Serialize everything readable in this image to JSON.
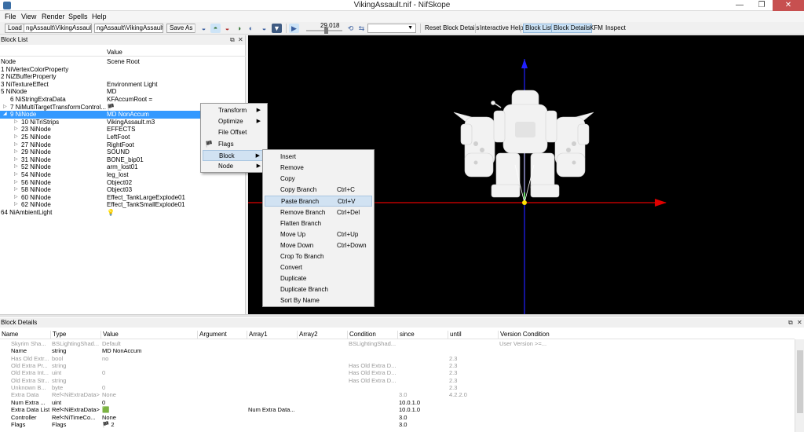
{
  "window": {
    "title": "VikingAssault.nif - NifSkope",
    "min": "—",
    "max": "❐",
    "close": "✕"
  },
  "menubar": [
    "File",
    "View",
    "Render",
    "Spells",
    "Help"
  ],
  "toolbar": {
    "load": "Load",
    "path1": "ngAssault\\VikingAssault.nif",
    "path2": "ngAssault\\VikingAssault.nif",
    "save_as": "Save As",
    "time": "29.018",
    "reset_block_details": "Reset Block Details",
    "interactive_help": "Interactive Help",
    "block_list": "Block List",
    "block_details": "Block Details",
    "kfm": "KFM",
    "inspect": "Inspect"
  },
  "blocklist": {
    "title": "Block List",
    "col_value": "Value",
    "rows": [
      {
        "name": "Node",
        "value": "Scene Root",
        "indent": 0,
        "tri": ""
      },
      {
        "name": "1 NiVertexColorProperty",
        "value": "",
        "indent": 0,
        "tri": ""
      },
      {
        "name": "2 NiZBufferProperty",
        "value": "",
        "indent": 0,
        "tri": ""
      },
      {
        "name": "3 NiTextureEffect",
        "value": "Environment Light",
        "indent": 0,
        "tri": ""
      },
      {
        "name": "5 NiNode",
        "value": "MD",
        "indent": 0,
        "tri": ""
      },
      {
        "name": "6 NiStringExtraData",
        "value": "KFAccumRoot =",
        "indent": 1,
        "tri": ""
      },
      {
        "name": "7 NiMultiTargetTransformControl...",
        "value": "🏴",
        "indent": 1,
        "tri": "▷"
      },
      {
        "name": "9 NiNode",
        "value": "MD NonAccum",
        "indent": 1,
        "tri": "◢",
        "selected": true
      },
      {
        "name": "10 NiTriStrips",
        "value": "VikingAssault.m3",
        "indent": 2,
        "tri": "▷"
      },
      {
        "name": "23 NiNode",
        "value": "EFFECTS",
        "indent": 2,
        "tri": "▷"
      },
      {
        "name": "25 NiNode",
        "value": "LeftFoot",
        "indent": 2,
        "tri": "▷"
      },
      {
        "name": "27 NiNode",
        "value": "RightFoot",
        "indent": 2,
        "tri": "▷"
      },
      {
        "name": "29 NiNode",
        "value": "SOUND",
        "indent": 2,
        "tri": "▷"
      },
      {
        "name": "31 NiNode",
        "value": "BONE_bip01",
        "indent": 2,
        "tri": "▷"
      },
      {
        "name": "52 NiNode",
        "value": "arm_lost01",
        "indent": 2,
        "tri": "▷"
      },
      {
        "name": "54 NiNode",
        "value": "leg_lost",
        "indent": 2,
        "tri": "▷"
      },
      {
        "name": "56 NiNode",
        "value": "Object02",
        "indent": 2,
        "tri": "▷"
      },
      {
        "name": "58 NiNode",
        "value": "Object03",
        "indent": 2,
        "tri": "▷"
      },
      {
        "name": "60 NiNode",
        "value": "Effect_TankLargeExplode01",
        "indent": 2,
        "tri": "▷"
      },
      {
        "name": "62 NiNode",
        "value": "Effect_TankSmallExplode01",
        "indent": 2,
        "tri": "▷"
      },
      {
        "name": "64 NiAmbientLight",
        "value": "💡",
        "indent": 0,
        "tri": ""
      }
    ]
  },
  "context_menu": {
    "items": [
      {
        "label": "Transform",
        "submenu": true,
        "icon": ""
      },
      {
        "label": "Optimize",
        "submenu": true,
        "icon": ""
      },
      {
        "label": "File Offset",
        "submenu": false,
        "icon": ""
      },
      {
        "label": "Flags",
        "submenu": false,
        "icon": "🏴"
      },
      {
        "label": "Block",
        "submenu": true,
        "icon": "",
        "highlighted": true
      },
      {
        "label": "Node",
        "submenu": true,
        "icon": ""
      }
    ]
  },
  "block_submenu": {
    "items": [
      {
        "label": "Insert",
        "shortcut": ""
      },
      {
        "label": "Remove",
        "shortcut": ""
      },
      {
        "label": "Copy",
        "shortcut": ""
      },
      {
        "label": "Copy Branch",
        "shortcut": "Ctrl+C"
      },
      {
        "label": "Paste Branch",
        "shortcut": "Ctrl+V",
        "highlighted": true
      },
      {
        "label": "Remove Branch",
        "shortcut": "Ctrl+Del"
      },
      {
        "label": "Flatten Branch",
        "shortcut": ""
      },
      {
        "label": "Move Up",
        "shortcut": "Ctrl+Up"
      },
      {
        "label": "Move Down",
        "shortcut": "Ctrl+Down"
      },
      {
        "label": "Crop To Branch",
        "shortcut": ""
      },
      {
        "label": "Convert",
        "shortcut": ""
      },
      {
        "label": "Duplicate",
        "shortcut": ""
      },
      {
        "label": "Duplicate Branch",
        "shortcut": ""
      },
      {
        "label": "Sort By Name",
        "shortcut": ""
      }
    ]
  },
  "block_details": {
    "title": "Block Details",
    "columns": [
      "Name",
      "Type",
      "Value",
      "Argument",
      "Array1",
      "Array2",
      "Condition",
      "since",
      "until",
      "Version Condition"
    ],
    "rows": [
      {
        "dim": true,
        "cells": [
          "Skyrim Sha...",
          "BSLightingShad...",
          "Default",
          "",
          "",
          "",
          "BSLightingShad...",
          "",
          "",
          "User Version >=..."
        ]
      },
      {
        "dim": false,
        "cells": [
          "Name",
          "string",
          "MD NonAccum",
          "",
          "",
          "",
          "",
          "",
          "",
          ""
        ]
      },
      {
        "dim": true,
        "cells": [
          "Has Old Extr...",
          "bool",
          "no",
          "",
          "",
          "",
          "",
          "",
          "2.3",
          ""
        ]
      },
      {
        "dim": true,
        "cells": [
          "Old Extra Pr...",
          "string",
          "",
          "",
          "",
          "",
          "Has Old Extra D...",
          "",
          "2.3",
          ""
        ]
      },
      {
        "dim": true,
        "cells": [
          "Old Extra Int...",
          "uint",
          "0",
          "",
          "",
          "",
          "Has Old Extra D...",
          "",
          "2.3",
          ""
        ]
      },
      {
        "dim": true,
        "cells": [
          "Old Extra Str...",
          "string",
          "",
          "",
          "",
          "",
          "Has Old Extra D...",
          "",
          "2.3",
          ""
        ]
      },
      {
        "dim": true,
        "cells": [
          "Unknown B...",
          "byte",
          "0",
          "",
          "",
          "",
          "",
          "",
          "2.3",
          ""
        ]
      },
      {
        "dim": true,
        "cells": [
          "Extra Data",
          "Ref<NiExtraData>",
          "None",
          "",
          "",
          "",
          "",
          "3.0",
          "4.2.2.0",
          ""
        ]
      },
      {
        "dim": false,
        "cells": [
          "Num Extra ...",
          "uint",
          "0",
          "",
          "",
          "",
          "",
          "10.0.1.0",
          "",
          ""
        ]
      },
      {
        "dim": false,
        "cells": [
          "Extra Data List",
          "Ref<NiExtraData>",
          "🟩",
          "",
          "Num Extra Data...",
          "",
          "",
          "10.0.1.0",
          "",
          ""
        ]
      },
      {
        "dim": false,
        "cells": [
          "Controller",
          "Ref<NiTimeCo...",
          "None",
          "",
          "",
          "",
          "",
          "3.0",
          "",
          ""
        ]
      },
      {
        "dim": false,
        "cells": [
          "Flags",
          "Flags",
          "🏴 2",
          "",
          "",
          "",
          "",
          "3.0",
          "",
          ""
        ]
      }
    ]
  },
  "colors": {
    "selection": "#3399ff",
    "menu_highlight": "#d1e2f2",
    "viewport_bg": "#000000",
    "axis_x": "#e00000",
    "axis_y": "#2020ff",
    "axis_z": "#00c000",
    "close_button": "#c75050"
  },
  "icons": [
    "window-app-icon",
    "eye-icon",
    "shading-icon",
    "texture-icon",
    "lighting-icon",
    "play-icon",
    "loop-icon",
    "pingpong-icon",
    "dropdown-arrow-icon",
    "dock-float-icon",
    "close-icon",
    "flag-icon",
    "bulb-icon"
  ]
}
